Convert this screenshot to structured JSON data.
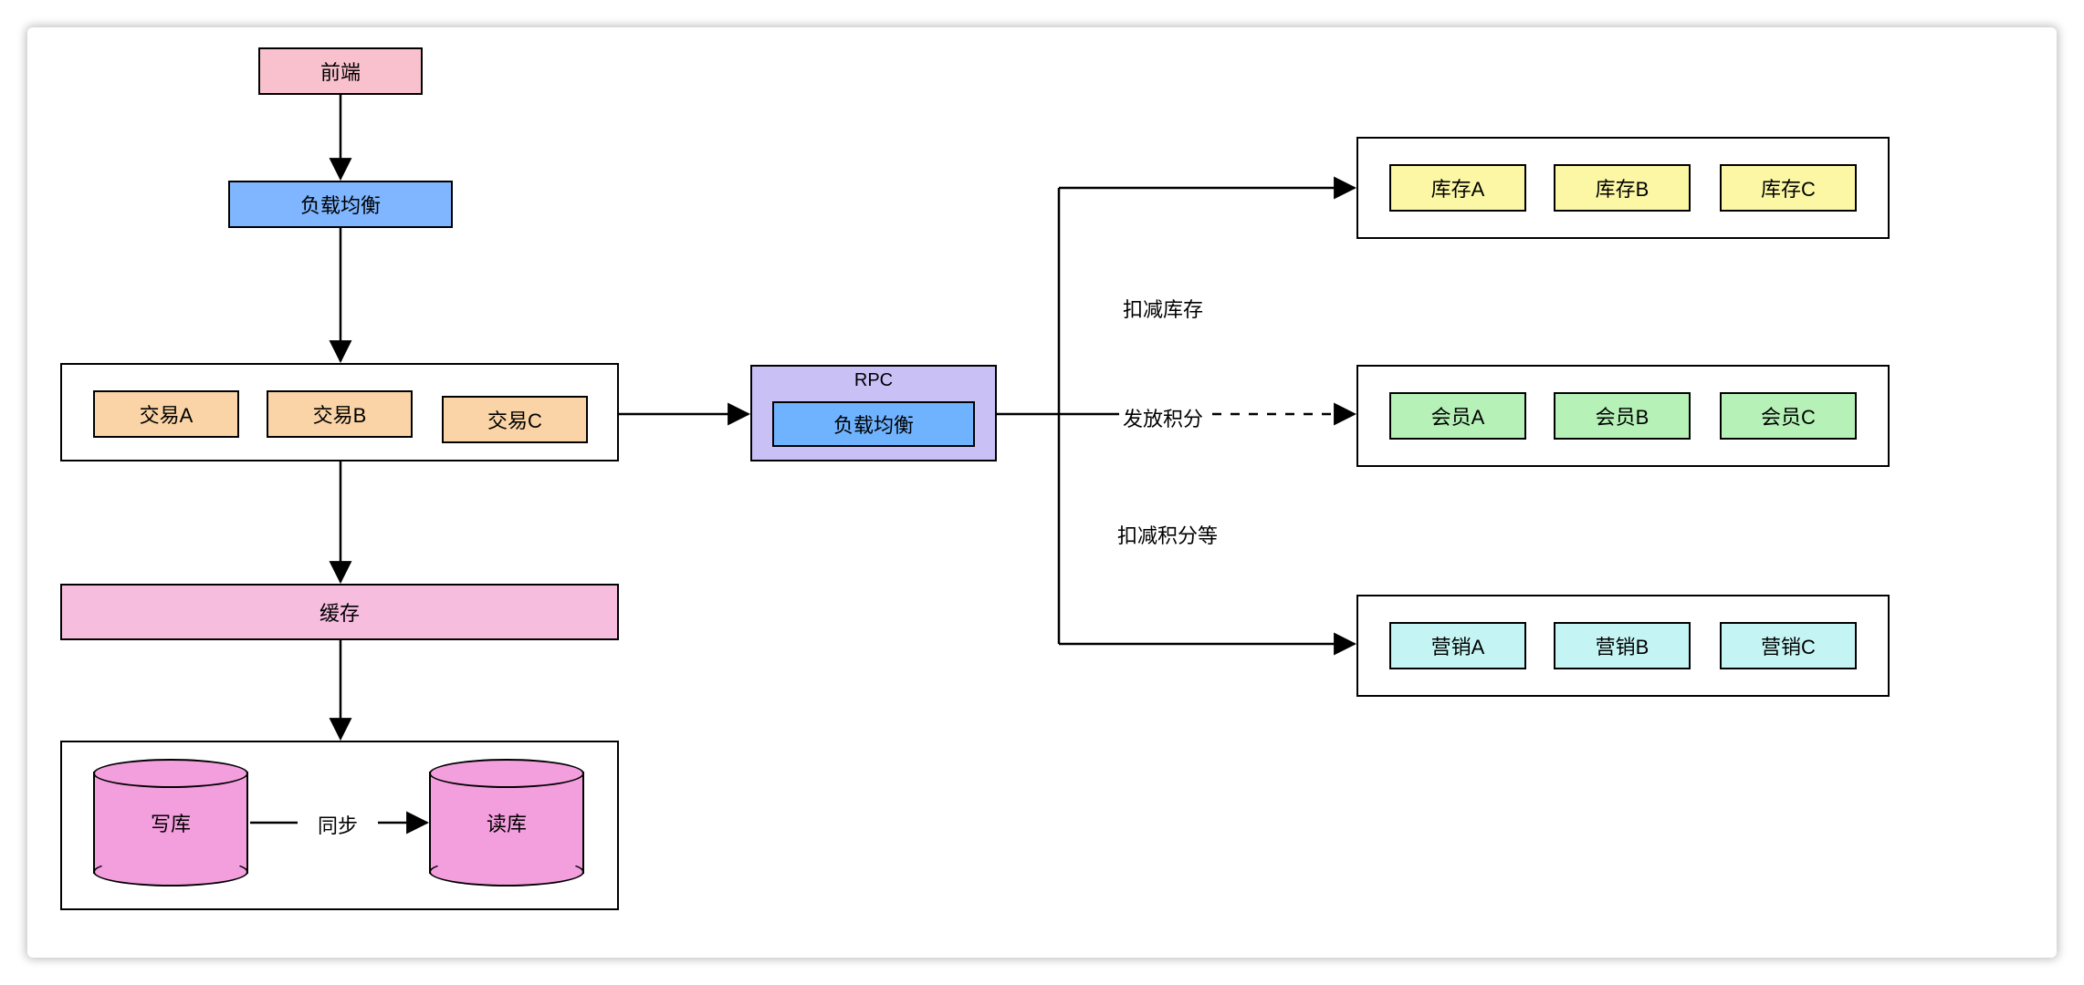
{
  "nodes": {
    "frontend": "前端",
    "lb_front": "负载均衡",
    "tx_a": "交易A",
    "tx_b": "交易B",
    "tx_c": "交易C",
    "cache": "缓存",
    "write_db": "写库",
    "read_db": "读库",
    "sync": "同步",
    "rpc_title": "RPC",
    "rpc_lb": "负载均衡",
    "stock_a": "库存A",
    "stock_b": "库存B",
    "stock_c": "库存C",
    "member_a": "会员A",
    "member_b": "会员B",
    "member_c": "会员C",
    "mkt_a": "营销A",
    "mkt_b": "营销B",
    "mkt_c": "营销C"
  },
  "edges": {
    "deduct_stock": "扣减库存",
    "grant_points": "发放积分",
    "deduct_points": "扣减积分等"
  },
  "colors": {
    "pink": "#f8c1cd",
    "blue": "#7fb6ff",
    "orange": "#fad4a6",
    "rose": "#f7bddf",
    "magenta": "#f39fdd",
    "violet": "#c9c1f5",
    "skyblue": "#6fb3ff",
    "yellow": "#fbf7a5",
    "green": "#b6f1b8",
    "cyan": "#c4f5f4"
  }
}
